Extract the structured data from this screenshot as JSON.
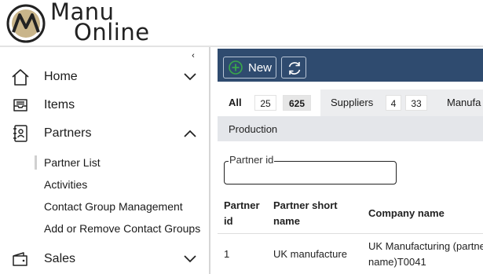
{
  "app": {
    "logo_line1": "Manu",
    "logo_line2": "Online"
  },
  "sidebar": {
    "collapse_glyph": "‹",
    "items": [
      {
        "label": "Home",
        "icon": "home-icon",
        "chevron": "down"
      },
      {
        "label": "Items",
        "icon": "inbox-tray-icon"
      },
      {
        "label": "Partners",
        "icon": "contacts-book-icon",
        "chevron": "up"
      },
      {
        "label": "Sales",
        "icon": "wallet-icon",
        "chevron": "down"
      }
    ],
    "partner_subitems": [
      {
        "label": "Partner List",
        "selected": true
      },
      {
        "label": "Activities"
      },
      {
        "label": "Contact Group Management"
      },
      {
        "label": "Add or Remove Contact Groups"
      }
    ]
  },
  "toolbar": {
    "new_label": "New",
    "refresh_icon": "refresh-icon"
  },
  "tabs": [
    {
      "label": "All",
      "counts": [
        "25",
        "625"
      ],
      "active": true
    },
    {
      "label": "Suppliers",
      "counts": [
        "4",
        "33"
      ]
    },
    {
      "label": "Manufa"
    }
  ],
  "tabs_row2": [
    {
      "label": "Production"
    }
  ],
  "filter": {
    "label": "Partner id",
    "value": ""
  },
  "table": {
    "headers": {
      "partner_id": [
        "Partner",
        "id"
      ],
      "short_name": [
        "Partner short",
        "name"
      ],
      "company_name": [
        "Company name"
      ]
    },
    "rows": [
      {
        "partner_id": "1",
        "short_name": "UK manufacture",
        "company_name": [
          "UK Manufacturing (partne",
          "name)T0041"
        ]
      }
    ]
  },
  "colors": {
    "toolbar_bg": "#2f4b6f",
    "plus_green": "#3aa84a",
    "tab_bar_bg": "#ecedef"
  }
}
